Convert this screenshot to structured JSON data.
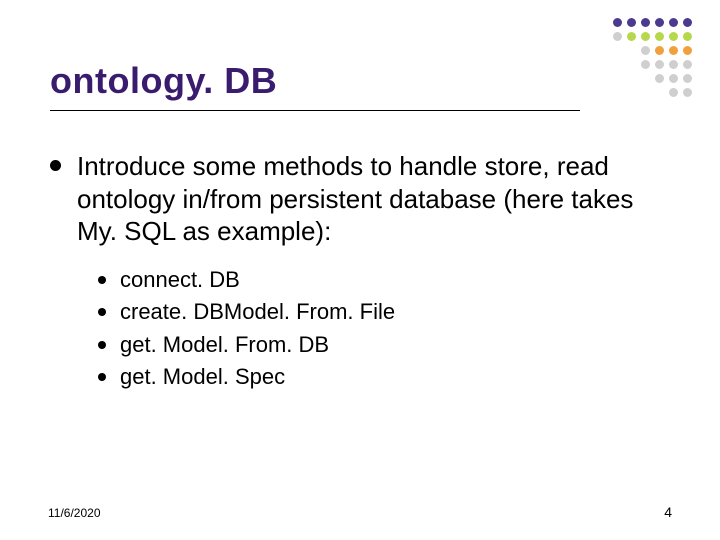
{
  "title": "ontology. DB",
  "main_point": "Introduce some methods to handle store, read ontology in/from persistent database (here takes My. SQL as example):",
  "sub_points": [
    "connect. DB",
    "create. DBModel. From. File",
    "get. Model. From. DB",
    "get. Model. Spec"
  ],
  "footer": {
    "date": "11/6/2020",
    "page": "4"
  },
  "deco_colors": {
    "purple": "#4b3a8f",
    "green": "#b7d84c",
    "orange": "#f0a03c",
    "grey": "#cfcfcf"
  }
}
